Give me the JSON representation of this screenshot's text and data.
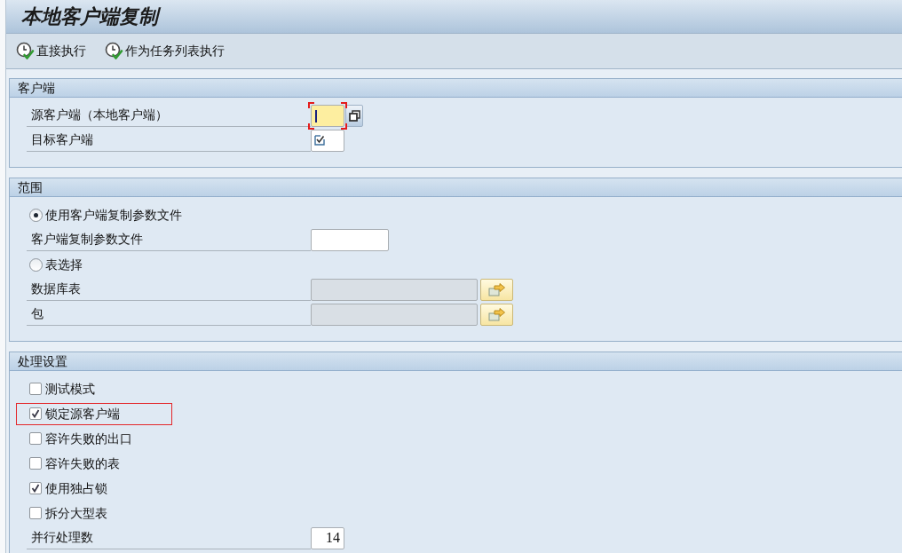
{
  "window": {
    "title": "本地客户端复制"
  },
  "toolbar": [
    {
      "label": "直接执行"
    },
    {
      "label": "作为任务列表执行"
    }
  ],
  "groups": [
    {
      "title": "客户端",
      "rows": [
        {
          "kind": "field",
          "label": "源客户端（本地客户端）",
          "focused": true,
          "disabled": false,
          "value_icon": false,
          "button": {
            "kind": "value_help"
          }
        },
        {
          "kind": "field",
          "label": "目标客户端",
          "focused": false,
          "disabled": false,
          "value_icon": true
        }
      ]
    },
    {
      "title": "范围",
      "rows": [
        {
          "kind": "radio",
          "label": "使用客户端复制参数文件",
          "selected": true
        },
        {
          "kind": "field",
          "label": "客户端复制参数文件",
          "focused": false,
          "disabled": false
        },
        {
          "kind": "radio",
          "label": "表选择",
          "selected": false
        },
        {
          "kind": "field",
          "label": "数据库表",
          "focused": false,
          "disabled": true,
          "button": {
            "kind": "multiple_selection"
          }
        },
        {
          "kind": "field",
          "label": "包",
          "focused": false,
          "disabled": true,
          "button": {
            "kind": "multiple_selection"
          }
        }
      ]
    },
    {
      "title": "处理设置",
      "rows": [
        {
          "kind": "checkbox",
          "label": "测试模式",
          "checked": false,
          "highlighted": false
        },
        {
          "kind": "checkbox",
          "label": "锁定源客户端",
          "checked": true,
          "highlighted": true
        },
        {
          "kind": "checkbox",
          "label": "容许失败的出口",
          "checked": false,
          "highlighted": false
        },
        {
          "kind": "checkbox",
          "label": "容许失败的表",
          "checked": false,
          "highlighted": false
        },
        {
          "kind": "checkbox",
          "label": "使用独占锁",
          "checked": true,
          "highlighted": false
        },
        {
          "kind": "checkbox",
          "label": "拆分大型表",
          "checked": false,
          "highlighted": false
        },
        {
          "kind": "field",
          "label": "并行处理数",
          "value": "14",
          "focused": false,
          "disabled": false,
          "highlighted": false
        }
      ]
    }
  ]
}
